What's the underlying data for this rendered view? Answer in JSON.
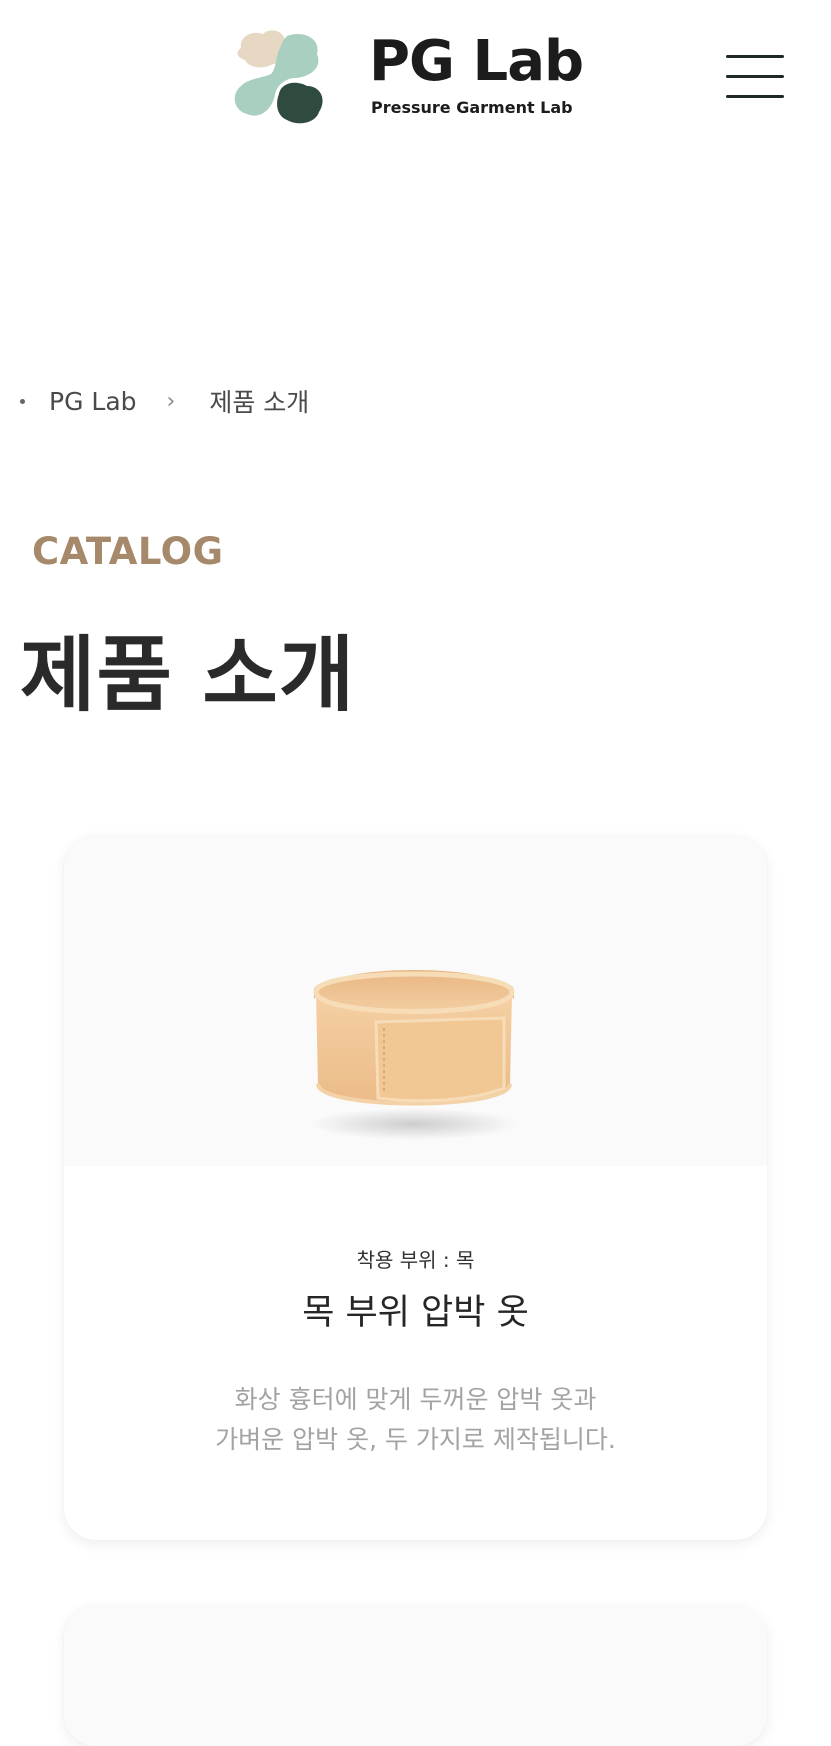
{
  "header": {
    "logo_title": "PG Lab",
    "logo_subtitle": "Pressure Garment Lab",
    "menu_icon": "hamburger-menu-icon"
  },
  "breadcrumb": {
    "items": [
      "PG Lab",
      "제품 소개"
    ],
    "separator": "›"
  },
  "section": {
    "eyebrow": "CATALOG",
    "title": "제품 소개"
  },
  "products": [
    {
      "area": "착용 부위 : 목",
      "name": "목 부위 압박 옷",
      "description_lines": [
        "화상 흉터에 맞게 두꺼운 압박 옷과",
        "가벼운 압박 옷, 두 가지로 제작됩니다."
      ],
      "image_icon": "neck-compression-band-image"
    }
  ],
  "colors": {
    "accent": "#a6896a",
    "logo_beige": "#e6d8c2",
    "logo_mint": "#a9cfc0",
    "logo_dark": "#2f4a3e",
    "product_skin": "#f2c99b"
  }
}
